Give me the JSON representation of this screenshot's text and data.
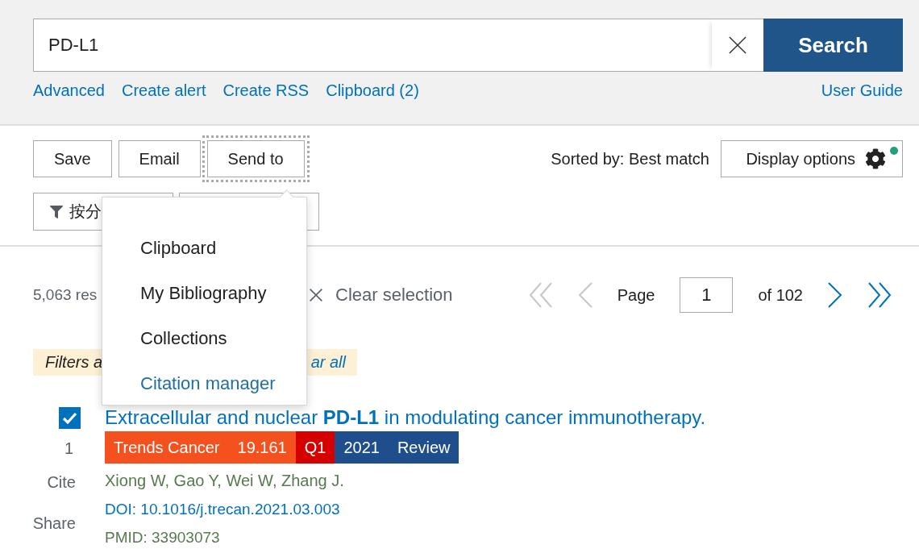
{
  "search": {
    "query": "PD-L1",
    "button": "Search"
  },
  "search_links": [
    "Advanced",
    "Create alert",
    "Create RSS",
    "Clipboard (2)"
  ],
  "user_guide": "User Guide",
  "toolbar": {
    "actions": [
      {
        "label": "Save",
        "focused": false
      },
      {
        "label": "Email",
        "focused": false
      },
      {
        "label": "Send to",
        "focused": true
      }
    ],
    "sort": "Sorted by: Best match",
    "display_options": {
      "label": "Display options",
      "notice": true
    }
  },
  "filter_buttons": [
    {
      "kind": "filter",
      "label": "按分"
    },
    {
      "kind": "covered"
    }
  ],
  "send_to_menu": [
    {
      "label": "Clipboard",
      "selected": false
    },
    {
      "label": "My Bibliography",
      "selected": false
    },
    {
      "label": "Collections",
      "selected": false
    },
    {
      "label": "Citation manager",
      "selected": true
    }
  ],
  "results": {
    "count": "5,063 res",
    "clear_selection": "Clear selection"
  },
  "pagination": {
    "back": [
      {
        "kind": "first",
        "disabled": true
      },
      {
        "kind": "prev",
        "disabled": true
      }
    ],
    "page_label": "Page",
    "page": "1",
    "total": "of 102",
    "forward": [
      {
        "kind": "next",
        "disabled": false
      },
      {
        "kind": "last",
        "disabled": false
      }
    ]
  },
  "filter_notice": {
    "text": "Filters a",
    "link": "ar all"
  },
  "articles": [
    {
      "checked": true,
      "number": "1",
      "title": "Extracellular and nuclear **PD-L1** in modulating cancer immunotherapy.",
      "badges": [
        {
          "label": "Trends Cancer",
          "color": "#f4511e"
        },
        {
          "label": "19.161",
          "color": "#f4511e"
        },
        {
          "label": "Q1",
          "color": "#d50000"
        },
        {
          "label": "2021",
          "color": "#1f4e8c"
        },
        {
          "label": "Review",
          "color": "#1f4e8c"
        }
      ],
      "authors": "Xiong W, Gao Y, Wei W, Zhang J.",
      "doi": "DOI: 10.1016/j.trecan.2021.03.003",
      "pmid": "PMID: 33903073",
      "actions": [
        "Cite",
        "Share"
      ]
    }
  ]
}
